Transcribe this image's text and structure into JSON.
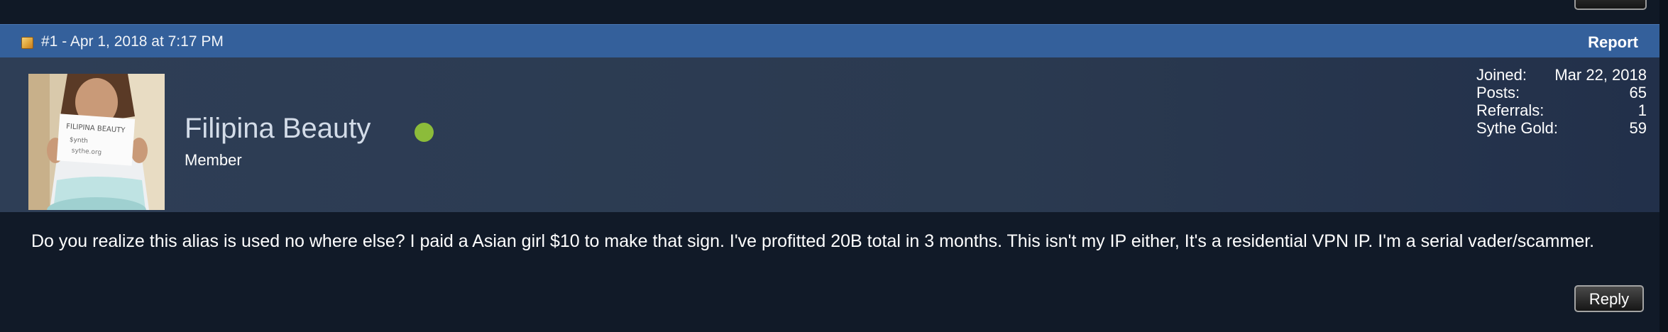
{
  "post": {
    "meta": "#1 - Apr 1, 2018 at 7:17 PM",
    "report_label": "Report",
    "reply_label": "Reply",
    "body": "Do you realize this alias is used no where else? I paid a Asian girl $10 to make that sign. I've profitted 20B total in 3 months. This isn't my IP either, It's a residential VPN IP. I'm a serial vader/scammer."
  },
  "user": {
    "name": "Filipina Beauty",
    "title": "Member",
    "online": true,
    "stats": [
      {
        "label": "Joined:",
        "value": "Mar 22, 2018"
      },
      {
        "label": "Posts:",
        "value": "65"
      },
      {
        "label": "Referrals:",
        "value": "1"
      },
      {
        "label": "Sythe Gold:",
        "value": "59"
      }
    ]
  },
  "colors": {
    "header": "#34609b",
    "panel": "#2e3e56",
    "background": "#111a28",
    "online": "#8cbc3a"
  },
  "icons": {
    "post": "post-icon",
    "status": "online-status-icon"
  }
}
